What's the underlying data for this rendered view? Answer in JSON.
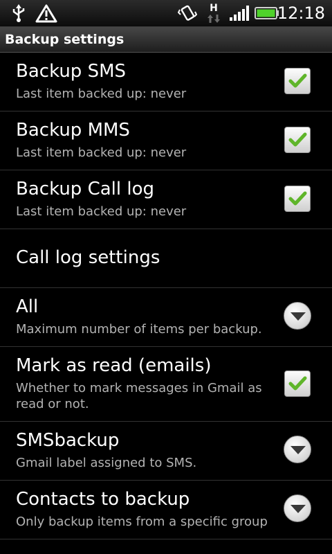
{
  "status": {
    "time": "12:18",
    "network": "H"
  },
  "header": {
    "title": "Backup settings"
  },
  "prefs": [
    {
      "title": "Backup SMS",
      "summary": "Last item backed up: never",
      "widget": "checkbox",
      "checked": true
    },
    {
      "title": "Backup MMS",
      "summary": "Last item backed up: never",
      "widget": "checkbox",
      "checked": true
    },
    {
      "title": "Backup Call log",
      "summary": "Last item backed up: never",
      "widget": "checkbox",
      "checked": true
    },
    {
      "title": "Call log settings",
      "summary": "",
      "widget": "none"
    },
    {
      "title": "All",
      "summary": "Maximum number of items per backup.",
      "widget": "dropdown"
    },
    {
      "title": "Mark as read (emails)",
      "summary": "Whether to mark messages in Gmail as read or not.",
      "widget": "checkbox",
      "checked": true
    },
    {
      "title": "SMSbackup",
      "summary": "Gmail label assigned to SMS.",
      "widget": "dropdown"
    },
    {
      "title": "Contacts to backup",
      "summary": "Only backup items from a specific group",
      "widget": "dropdown"
    }
  ],
  "colors": {
    "checkmark": "#5fb52a",
    "summary_text": "#b3b3b3",
    "battery": "#4fd22b"
  }
}
